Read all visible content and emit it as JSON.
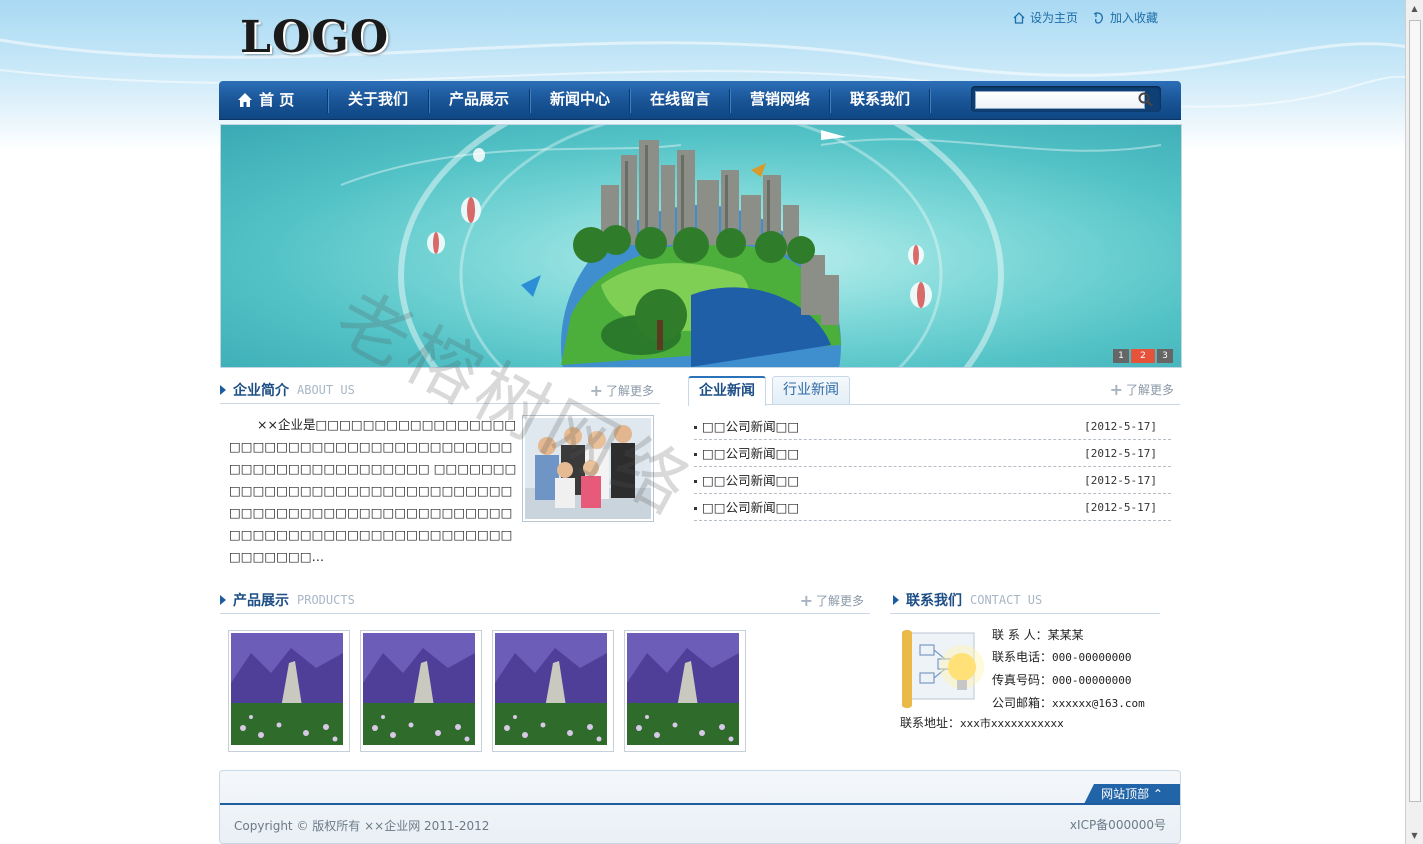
{
  "header": {
    "logo": "LOGO",
    "set_home": "设为主页",
    "add_favorite": "加入收藏"
  },
  "nav": {
    "items": [
      "首 页",
      "关于我们",
      "产品展示",
      "新闻中心",
      "在线留言",
      "营销网络",
      "联系我们"
    ],
    "search_value": ""
  },
  "banner": {
    "pages": [
      "1",
      "2",
      "3"
    ],
    "active_page": "2"
  },
  "watermark": "老榕树网络",
  "about": {
    "title": "企业简介",
    "title_en": "ABOUT US",
    "more": "了解更多",
    "text": "××企业是□□□□□□□□□□□□□□□□□□□□□□□□□□□□□□□□□□□□□□□□□□□□□□□□□□□□□□□□□□ □□□□□□□□□□□□□□□□□□□□□□□□□□□□□□□□□□□□□□□□□□□□□□□□□□□□□□□□□□□□□□□□□□□□□□□□□□□□□□□□□□□□□□…"
  },
  "news": {
    "tab_active": "企业新闻",
    "tab_inactive": "行业新闻",
    "more": "了解更多",
    "items": [
      {
        "title": "□□公司新闻□□",
        "date": "[2012-5-17]"
      },
      {
        "title": "□□公司新闻□□",
        "date": "[2012-5-17]"
      },
      {
        "title": "□□公司新闻□□",
        "date": "[2012-5-17]"
      },
      {
        "title": "□□公司新闻□□",
        "date": "[2012-5-17]"
      }
    ]
  },
  "products": {
    "title": "产品展示",
    "title_en": "PRODUCTS",
    "more": "了解更多"
  },
  "contact": {
    "title": "联系我们",
    "title_en": "CONTACT US",
    "person_label": "联 系 人：",
    "person": "某某某",
    "phone_label": "联系电话：",
    "phone": "000-00000000",
    "fax_label": "传真号码：",
    "fax": "000-00000000",
    "email_label": "公司邮箱：",
    "email": "xxxxxx@163.com",
    "address_label": "联系地址：",
    "address": "xxx市xxxxxxxxxxx"
  },
  "footer": {
    "to_top": "网站顶部 ⌃",
    "copyright": "Copyright © 版权所有 ××企业网 2011-2012",
    "icp": "xICP备000000号"
  },
  "colors": {
    "nav_blue": "#1a5597",
    "title_blue": "#1d4f86",
    "pager_active": "#e7533a"
  }
}
